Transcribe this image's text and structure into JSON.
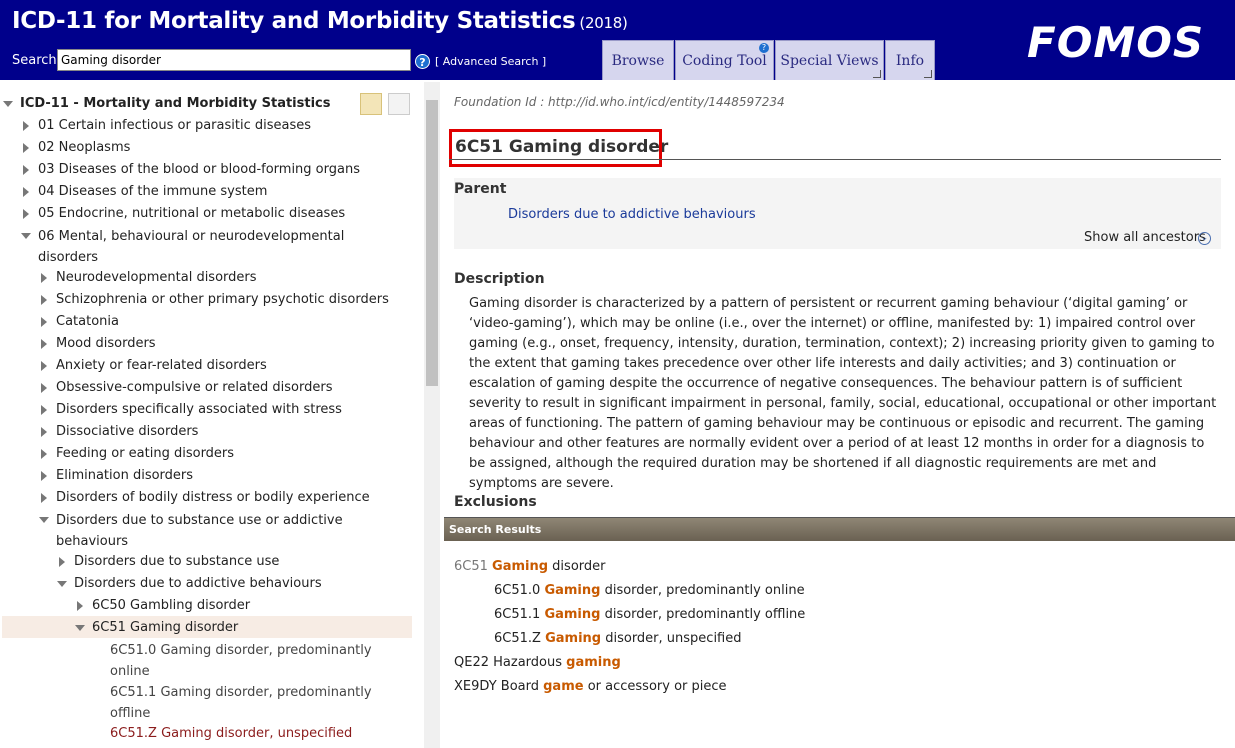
{
  "header": {
    "title": "ICD-11 for Mortality and Morbidity Statistics",
    "year": "(2018)",
    "search_label": "Search",
    "search_value": "Gaming disorder",
    "help": "?",
    "advanced_search": "[ Advanced Search ]",
    "tabs": [
      "Browse",
      "Coding Tool",
      "Special Views",
      "Info"
    ],
    "coding_badge": "?",
    "logo": "FOMOS"
  },
  "tree": {
    "root": "ICD-11 - Mortality and Morbidity Statistics",
    "chapters": [
      "01 Certain infectious or parasitic diseases",
      "02 Neoplasms",
      "03 Diseases of the blood or blood-forming organs",
      "04 Diseases of the immune system",
      "05 Endocrine, nutritional or metabolic diseases",
      "06 Mental, behavioural or neurodevelopmental disorders"
    ],
    "mental": [
      "Neurodevelopmental disorders",
      "Schizophrenia or other primary psychotic disorders",
      "Catatonia",
      "Mood disorders",
      "Anxiety or fear-related disorders",
      "Obsessive-compulsive or related disorders",
      "Disorders specifically associated with stress",
      "Dissociative disorders",
      "Feeding or eating disorders",
      "Elimination disorders",
      "Disorders of bodily distress or bodily experience",
      "Disorders due to substance use or addictive behaviours"
    ],
    "substance": [
      "Disorders due to substance use",
      "Disorders due to addictive behaviours"
    ],
    "addictive": [
      "6C50 Gambling disorder",
      "6C51 Gaming disorder"
    ],
    "leaves": [
      {
        "code": "6C51.0",
        "label": "Gaming disorder, predominantly online"
      },
      {
        "code": "6C51.1",
        "label": "Gaming disorder, predominantly offline"
      },
      {
        "code": "6C51.Z",
        "label": "Gaming disorder, unspecified"
      }
    ]
  },
  "detail": {
    "foundation_id": "Foundation Id : http://id.who.int/icd/entity/1448597234",
    "title": "6C51 Gaming disorder",
    "parent_heading": "Parent",
    "parent_link": "Disorders due to addictive behaviours",
    "show_ancestors": "Show all ancestors",
    "description_heading": "Description",
    "description": "Gaming disorder is characterized by a pattern of persistent or recurrent gaming behaviour (‘digital gaming’ or ‘video-gaming’), which may be online (i.e., over the internet) or offline, manifested by: 1) impaired control over gaming (e.g., onset, frequency, intensity, duration, termination, context); 2) increasing priority given to gaming to the extent that gaming takes precedence over other life interests and daily activities; and 3) continuation or escalation of gaming despite the occurrence of negative consequences. The behaviour pattern is of sufficient severity to result in significant impairment in personal, family, social, educational, occupational or other important areas of functioning. The pattern of gaming behaviour may be continuous or episodic and recurrent. The gaming behaviour and other features are normally evident over a period of at least 12 months in order for a diagnosis to be assigned, although the required duration may be shortened if all diagnostic requirements are met and symptoms are severe.",
    "exclusions_heading": "Exclusions"
  },
  "search_results": {
    "title": "Search Results",
    "items": [
      {
        "code": "6C51",
        "pre": " ",
        "hl": "Gaming",
        "post": " disorder"
      },
      {
        "code": "6C51.0",
        "pre": " ",
        "hl": "Gaming",
        "post": " disorder, predominantly online"
      },
      {
        "code": "6C51.1",
        "pre": " ",
        "hl": "Gaming",
        "post": " disorder, predominantly offline"
      },
      {
        "code": "6C51.Z",
        "pre": " ",
        "hl": "Gaming",
        "post": " disorder, unspecified"
      },
      {
        "code": "QE22",
        "pre": " Hazardous ",
        "hl": "gaming",
        "post": ""
      },
      {
        "code": "XE9DY",
        "pre": " Board ",
        "hl": "game",
        "post": " or accessory or piece"
      }
    ]
  }
}
